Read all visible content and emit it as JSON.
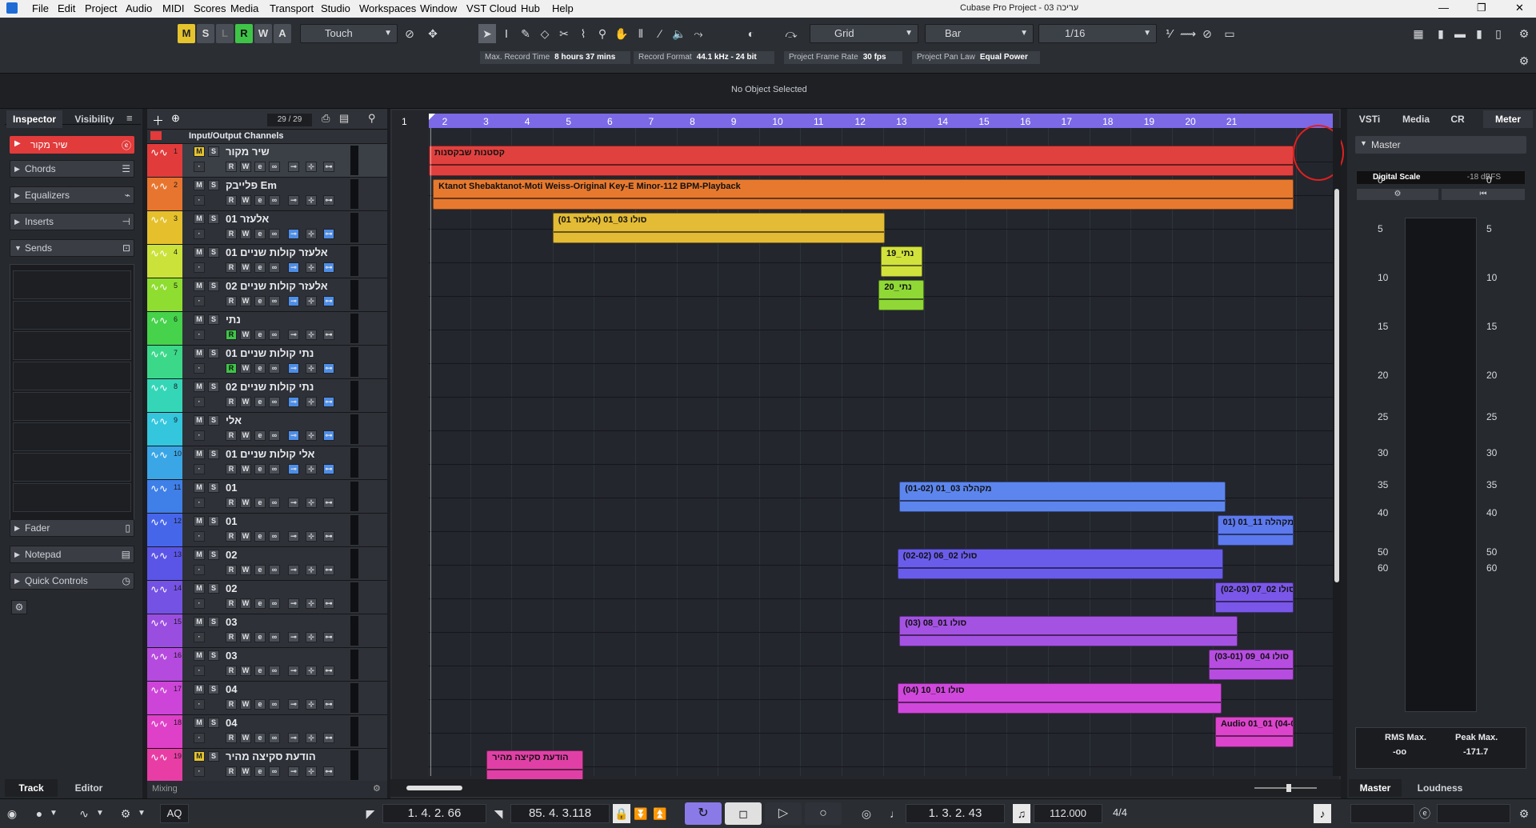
{
  "app": {
    "title": "Cubase Pro Project - 03 עריכה"
  },
  "menu": [
    "File",
    "Edit",
    "Project",
    "Audio",
    "MIDI",
    "Scores",
    "Media",
    "Transport",
    "Studio",
    "Workspaces",
    "Window",
    "VST Cloud",
    "Hub",
    "Help"
  ],
  "toolbar": {
    "msw": [
      "M",
      "S",
      "L",
      "R",
      "W",
      "A"
    ],
    "automation_mode": "Touch",
    "snap_type": "Grid",
    "grid_type": "Bar",
    "quantize": "1/16"
  },
  "infoline": [
    {
      "label": "Max. Record Time",
      "value": "8 hours 37 mins"
    },
    {
      "label": "Record Format",
      "value": "44.1 kHz - 24 bit"
    },
    {
      "label": "Project Frame Rate",
      "value": "30 fps"
    },
    {
      "label": "Project Pan Law",
      "value": "Equal Power"
    }
  ],
  "status": {
    "selection": "No Object Selected"
  },
  "inspector": {
    "tabs": [
      "Inspector",
      "Visibility"
    ],
    "track_name": "שיר מקור",
    "sections": [
      "Chords",
      "Equalizers",
      "Inserts",
      "Sends"
    ],
    "lower_sections": [
      "Fader",
      "Notepad",
      "Quick Controls"
    ],
    "bottom_tabs": [
      "Track",
      "Editor"
    ]
  },
  "tracklist": {
    "counter": "29 / 29",
    "folder": "Input/Output Channels",
    "footer": "Mixing",
    "tracks": [
      {
        "n": "1",
        "name": "שיר מקור",
        "color": "#e23b3b"
      },
      {
        "n": "2",
        "name": "פלייבק Em",
        "color": "#e8752f"
      },
      {
        "n": "3",
        "name": "אלעזר 01",
        "color": "#e5c02c"
      },
      {
        "n": "4",
        "name": "אלעזר קולות שניים 01",
        "color": "#cbe23a"
      },
      {
        "n": "5",
        "name": "אלעזר קולות שניים 02",
        "color": "#8fdd30"
      },
      {
        "n": "6",
        "name": "נתי",
        "color": "#46d24a"
      },
      {
        "n": "7",
        "name": "נתי קולות שניים 01",
        "color": "#3cd88a"
      },
      {
        "n": "8",
        "name": "נתי קולות שניים 02",
        "color": "#35d6b8"
      },
      {
        "n": "9",
        "name": "אלי",
        "color": "#33c6dd"
      },
      {
        "n": "10",
        "name": "אלי קולות שניים 01",
        "color": "#3aa6e6"
      },
      {
        "n": "11",
        "name": "01",
        "color": "#3f7fe8"
      },
      {
        "n": "12",
        "name": "01",
        "color": "#4666ea"
      },
      {
        "n": "13",
        "name": "02",
        "color": "#5a55e6"
      },
      {
        "n": "14",
        "name": "02",
        "color": "#7452e4"
      },
      {
        "n": "15",
        "name": "03",
        "color": "#9a4ee0"
      },
      {
        "n": "16",
        "name": "03",
        "color": "#b44ade"
      },
      {
        "n": "17",
        "name": "04",
        "color": "#cc45d8"
      },
      {
        "n": "18",
        "name": "04",
        "color": "#df40c8"
      },
      {
        "n": "19",
        "name": "הודעת סקיצה מהיר",
        "color": "#e83da4"
      }
    ]
  },
  "ruler": [
    "1",
    "2",
    "3",
    "4",
    "5",
    "6",
    "7",
    "8",
    "9",
    "10",
    "11",
    "12",
    "13",
    "14",
    "15",
    "16",
    "17",
    "18",
    "19",
    "20",
    "21"
  ],
  "clips": [
    {
      "row": 0,
      "bar0": 1.0,
      "bar1": 21.95,
      "label": "קסטנות שבקסנות",
      "color": "#e0413f"
    },
    {
      "row": 1,
      "bar0": 1.1,
      "bar1": 21.95,
      "label": "Ktanot Shebaktanot-Moti Weiss-Original Key-E Minor-112 BPM-Playback",
      "color": "#e7792f"
    },
    {
      "row": 2,
      "bar0": 4.0,
      "bar1": 12.05,
      "label": "(אלעזר 01) סולו 03_01",
      "color": "#e3bb35"
    },
    {
      "row": 3,
      "bar0": 11.95,
      "bar1": 12.95,
      "label": "נתי_19",
      "color": "#d2e23c"
    },
    {
      "row": 4,
      "bar0": 11.9,
      "bar1": 13.0,
      "label": "נתי_20",
      "color": "#8fd836"
    },
    {
      "row": 10,
      "bar0": 12.4,
      "bar1": 20.3,
      "label": "מקהלה 03_01 (01-02)",
      "color": "#5c86ee"
    },
    {
      "row": 11,
      "bar0": 20.1,
      "bar1": 21.95,
      "label": "מקהלה 11_01 (01-",
      "color": "#5c79ee"
    },
    {
      "row": 12,
      "bar0": 12.35,
      "bar1": 20.25,
      "label": "סולו 02_06 (02-02)",
      "color": "#6a5ceb"
    },
    {
      "row": 13,
      "bar0": 20.05,
      "bar1": 21.95,
      "label": "סולו 02_07 (02-03)",
      "color": "#7a57e8"
    },
    {
      "row": 14,
      "bar0": 12.4,
      "bar1": 20.6,
      "label": "סולו 01_08 (03)",
      "color": "#a452e2"
    },
    {
      "row": 15,
      "bar0": 19.9,
      "bar1": 21.95,
      "label": "סולו 04_09 (03-01)",
      "color": "#b64de0"
    },
    {
      "row": 16,
      "bar0": 12.35,
      "bar1": 20.2,
      "label": "סולו 01_10 (04)",
      "color": "#cf48db"
    },
    {
      "row": 17,
      "bar0": 20.05,
      "bar1": 21.95,
      "label": "Audio 01_01 (04-0",
      "color": "#dc44cc"
    },
    {
      "row": 18,
      "bar0": 2.4,
      "bar1": 4.75,
      "label": "הודעת סקיצה מהיר",
      "color": "#e040a5"
    }
  ],
  "rightzone": {
    "tabs": [
      "VSTi",
      "Media",
      "CR",
      "Meter"
    ],
    "channel": "Master",
    "scale_label": "Digital Scale",
    "scale_value": "-18 dBFS",
    "scale": [
      "0",
      "5",
      "10",
      "15",
      "20",
      "25",
      "30",
      "35",
      "40",
      "50",
      "60"
    ],
    "rms_label": "RMS Max.",
    "rms_value": "-oo",
    "peak_label": "Peak Max.",
    "peak_value": "-171.7",
    "bottom_tabs": [
      "Master",
      "Loudness"
    ]
  },
  "transport": {
    "left_locator": "1. 4. 2. 66",
    "right_locator": "85. 4. 3.118",
    "position": "1. 3. 2. 43",
    "tempo": "112.000",
    "signature": "4/4",
    "aq": "AQ"
  }
}
